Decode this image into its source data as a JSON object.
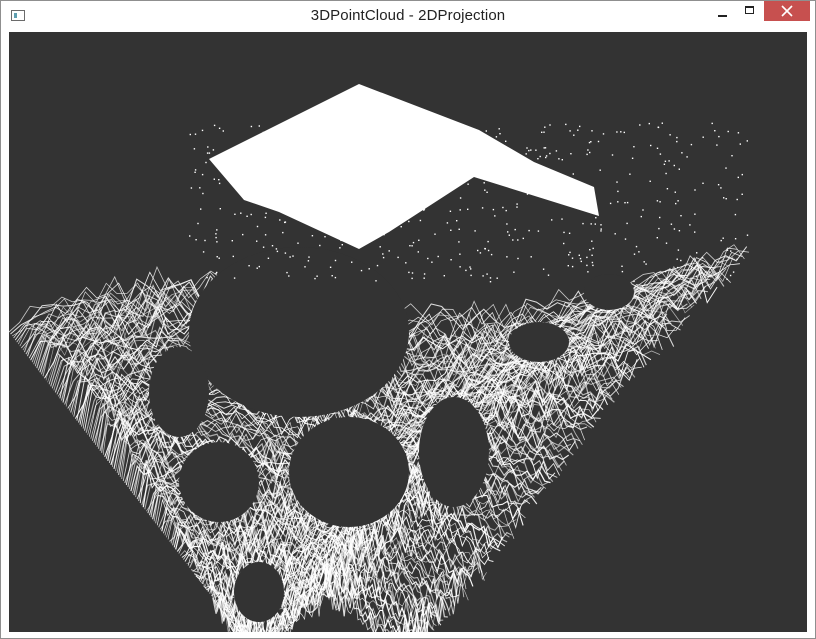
{
  "window": {
    "title": "3DPointCloud - 2DProjection",
    "icon": "app-window-icon",
    "controls": [
      "minimize-icon",
      "maximize-icon",
      "close-icon"
    ]
  },
  "viewport": {
    "background_color": "#333333",
    "point_color": "#ffffff",
    "close_button_color": "#c7504f"
  }
}
